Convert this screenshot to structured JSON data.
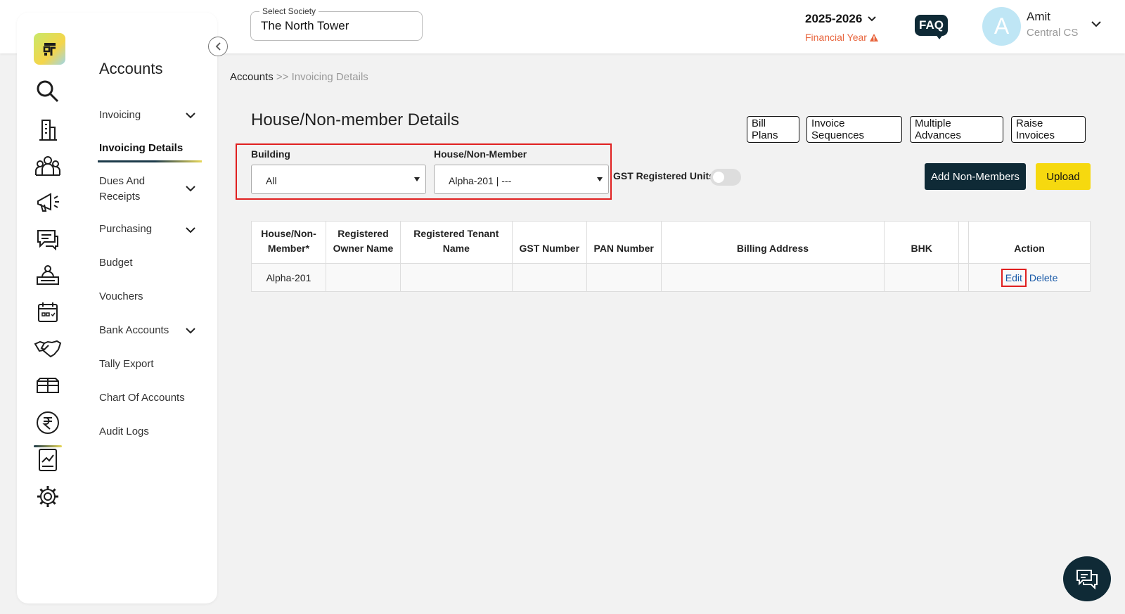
{
  "header": {
    "society_label": "Select Society",
    "society_value": "The North Tower",
    "year": "2025-2026",
    "fy_label": "Financial Year",
    "faq_label": "FAQ",
    "avatar_letter": "A",
    "user_name": "Amit",
    "user_role": "Central CS"
  },
  "sidebar": {
    "title": "Accounts",
    "items": [
      {
        "label": "Invoicing"
      },
      {
        "label": "Invoicing Details"
      },
      {
        "label": "Dues And Receipts"
      },
      {
        "label": "Purchasing"
      },
      {
        "label": "Budget"
      },
      {
        "label": "Vouchers"
      },
      {
        "label": "Bank Accounts"
      },
      {
        "label": "Tally Export"
      },
      {
        "label": "Chart Of Accounts"
      },
      {
        "label": "Audit Logs"
      }
    ]
  },
  "breadcrumb": {
    "root": "Accounts",
    "separator": " >> ",
    "current": "Invoicing Details"
  },
  "main": {
    "title": "House/Non-member Details",
    "buttons": {
      "bill_plans": "Bill Plans",
      "invoice_sequences": "Invoice Sequences",
      "multiple_advances": "Multiple Advances",
      "raise_invoices": "Raise Invoices",
      "add_non_members": "Add Non-Members",
      "upload": "Upload"
    },
    "filters": {
      "building_label": "Building",
      "building_value": "All",
      "house_label": "House/Non-Member",
      "house_value": "Alpha-201 | ---",
      "gst_label": "GST Registered Units"
    }
  },
  "table": {
    "headers": [
      "House/Non-Member*",
      "Registered Owner Name",
      "Registered Tenant Name",
      "GST Number",
      "PAN Number",
      "Billing Address",
      "BHK",
      "",
      "Action"
    ],
    "rows": [
      {
        "house": "Alpha-201",
        "owner": "",
        "tenant": "",
        "gst": "",
        "pan": "",
        "address": "",
        "bhk": "",
        "extra": "",
        "edit": "Edit",
        "delete": "Delete"
      }
    ]
  },
  "colors": {
    "accent_dark": "#0f2a36",
    "accent_yellow": "#f6d90f",
    "warning": "#e8643c",
    "highlight": "#e02020",
    "link": "#1a5aa8"
  }
}
